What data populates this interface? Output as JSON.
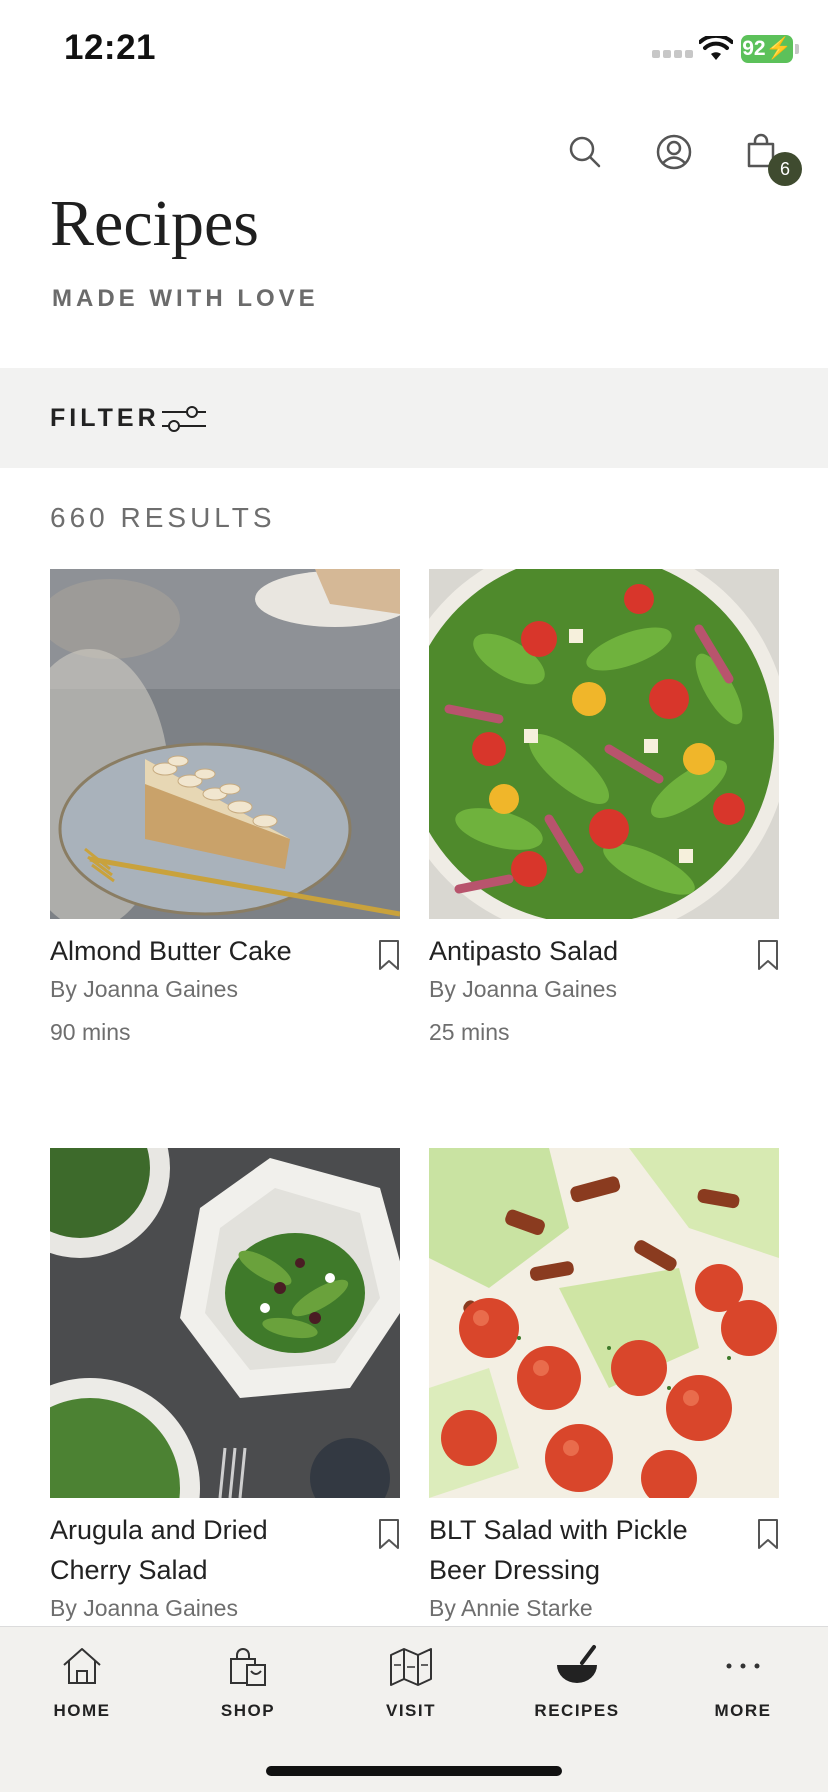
{
  "status": {
    "time": "12:21",
    "battery": "92"
  },
  "header": {
    "cart_count": "6"
  },
  "page": {
    "title": "Recipes",
    "subtitle": "MADE WITH LOVE"
  },
  "filter": {
    "label": "FILTER"
  },
  "results": {
    "count_text": "660 RESULTS"
  },
  "recipes": [
    {
      "title": "Almond Butter Cake",
      "author": "By Joanna Gaines",
      "time": "90 mins"
    },
    {
      "title": "Antipasto Salad",
      "author": "By Joanna Gaines",
      "time": "25 mins"
    },
    {
      "title": "Arugula and Dried Cherry Salad",
      "author": "By Joanna Gaines"
    },
    {
      "title": "BLT Salad with Pickle Beer Dressing",
      "author": "By Annie Starke"
    }
  ],
  "tabs": [
    {
      "label": "HOME",
      "icon": "home-icon"
    },
    {
      "label": "SHOP",
      "icon": "shopping-bag-icon"
    },
    {
      "label": "VISIT",
      "icon": "map-icon"
    },
    {
      "label": "RECIPES",
      "icon": "mortar-bowl-icon",
      "active": true
    },
    {
      "label": "MORE",
      "icon": "more-dots-icon"
    }
  ]
}
